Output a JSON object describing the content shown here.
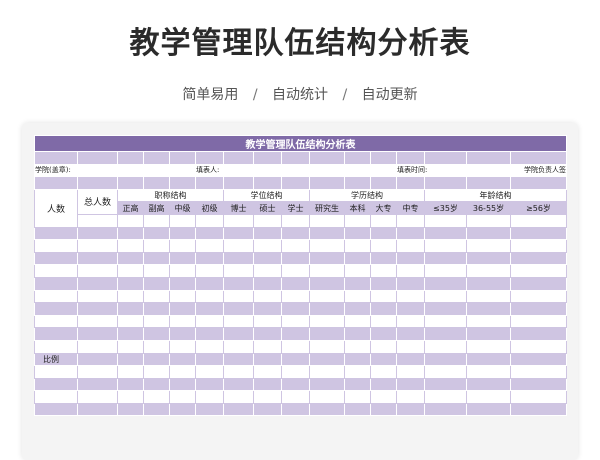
{
  "page": {
    "title": "教学管理队伍结构分析表",
    "tagline": [
      "简单易用",
      "自动统计",
      "自动更新"
    ]
  },
  "sheet": {
    "title": "教学管理队伍结构分析表",
    "info": {
      "college": "学院(盖章):",
      "filler": "填表人:",
      "date": "填表时间:",
      "responsible": "学院负责人签"
    },
    "headers": {
      "people": "人数",
      "total": "总人数",
      "groups": [
        "职称结构",
        "学位结构",
        "学历结构",
        "年龄结构"
      ],
      "title_cols": [
        "正高",
        "副高",
        "中级",
        "初级"
      ],
      "degree_cols": [
        "博士",
        "硕士",
        "学士"
      ],
      "edu_cols": [
        "研究生",
        "本科",
        "大专",
        "中专"
      ],
      "age_cols": [
        "≤35岁",
        "36-55岁",
        "≥56岁"
      ]
    },
    "ratio_label": "比例"
  }
}
